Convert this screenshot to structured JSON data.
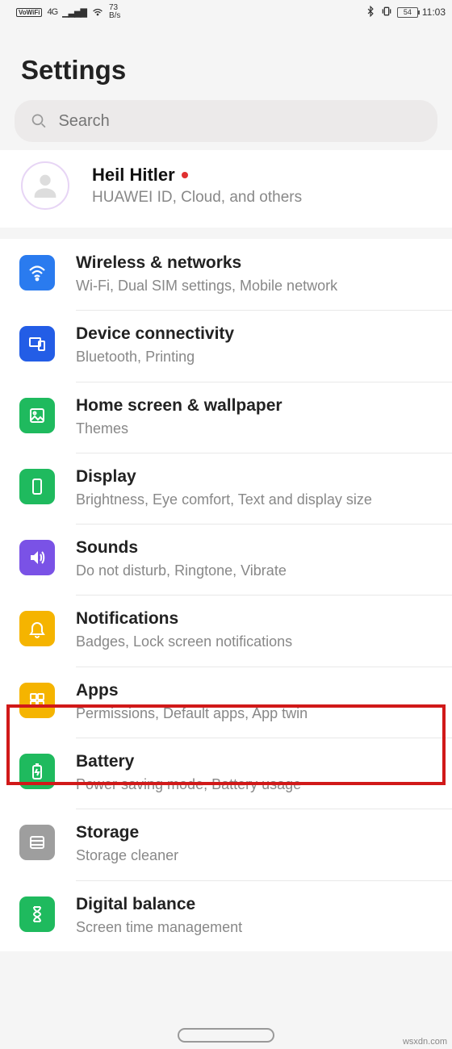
{
  "status": {
    "vowifi": "VoWiFi",
    "net_top": "73",
    "net_bottom": "B/s",
    "sig_label": "4G",
    "battery": "54",
    "time": "11:03"
  },
  "header": {
    "title": "Settings"
  },
  "search": {
    "placeholder": "Search"
  },
  "account": {
    "name": "Heil Hitler",
    "subtitle": "HUAWEI ID, Cloud, and others"
  },
  "items": [
    {
      "icon": "wifi-icon",
      "color": "bg-blue",
      "title": "Wireless & networks",
      "subtitle": "Wi-Fi, Dual SIM settings, Mobile network"
    },
    {
      "icon": "devices-icon",
      "color": "bg-blue2",
      "title": "Device connectivity",
      "subtitle": "Bluetooth, Printing"
    },
    {
      "icon": "wallpaper-icon",
      "color": "bg-green",
      "title": "Home screen & wallpaper",
      "subtitle": "Themes"
    },
    {
      "icon": "display-icon",
      "color": "bg-green",
      "title": "Display",
      "subtitle": "Brightness, Eye comfort, Text and display size"
    },
    {
      "icon": "sound-icon",
      "color": "bg-purple",
      "title": "Sounds",
      "subtitle": "Do not disturb, Ringtone, Vibrate"
    },
    {
      "icon": "bell-icon",
      "color": "bg-yellow",
      "title": "Notifications",
      "subtitle": "Badges, Lock screen notifications"
    },
    {
      "icon": "apps-icon",
      "color": "bg-yellow",
      "title": "Apps",
      "subtitle": "Permissions, Default apps, App twin"
    },
    {
      "icon": "battery-icon",
      "color": "bg-green",
      "title": "Battery",
      "subtitle": "Power saving mode, Battery usage"
    },
    {
      "icon": "storage-icon",
      "color": "bg-grey",
      "title": "Storage",
      "subtitle": "Storage cleaner"
    },
    {
      "icon": "balance-icon",
      "color": "bg-green",
      "title": "Digital balance",
      "subtitle": "Screen time management"
    }
  ],
  "watermark": "wsxdn.com",
  "highlighted_index": 6
}
